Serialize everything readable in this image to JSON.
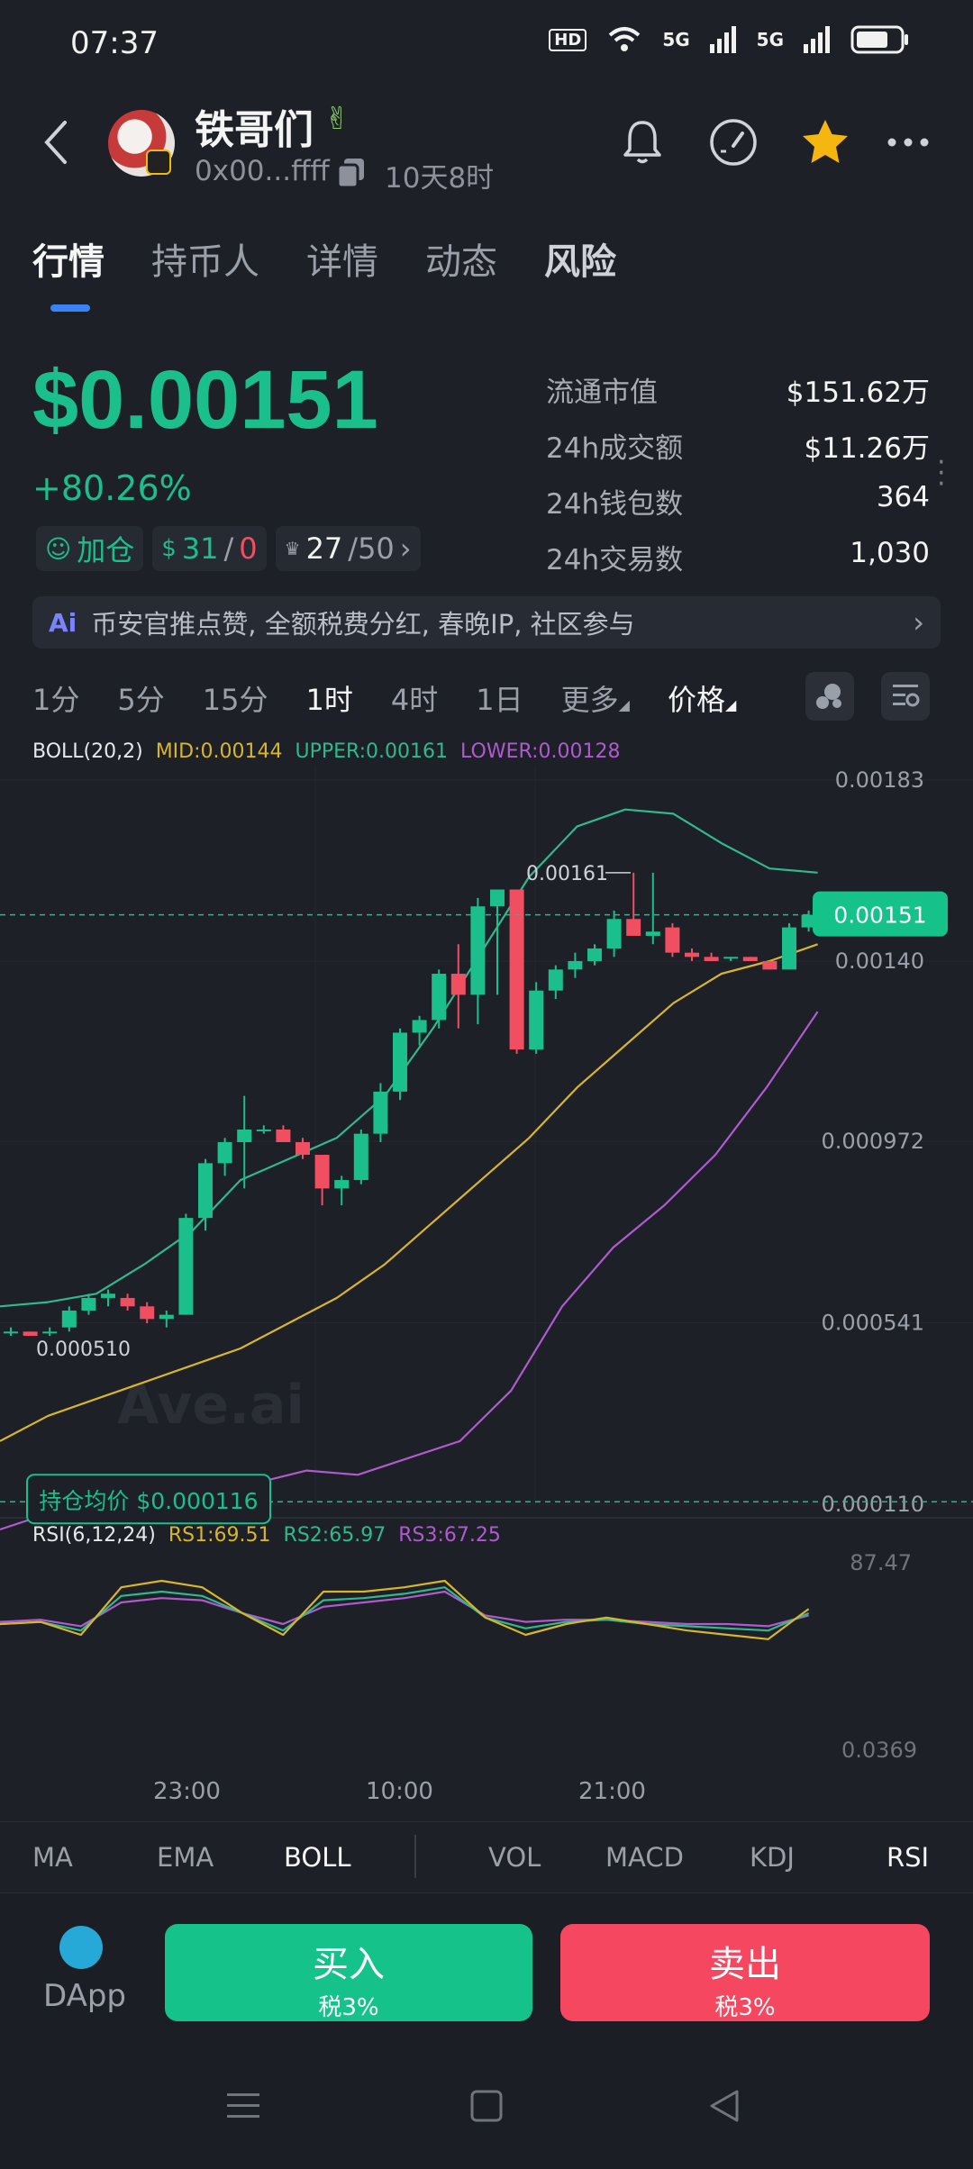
{
  "status_bar": {
    "time": "07:37",
    "hd_label": "HD",
    "net1": "5G",
    "net2": "5G"
  },
  "header": {
    "token_name": "铁哥们",
    "address": "0x00...ffff",
    "age": "10天8时"
  },
  "tabs": [
    "行情",
    "持币人",
    "详情",
    "动态",
    "风险"
  ],
  "price": {
    "value": "$0.00151",
    "change": "+80.26%"
  },
  "stats": [
    {
      "label": "流通市值",
      "value": "$151.62万"
    },
    {
      "label": "24h成交额",
      "value": "$11.26万"
    },
    {
      "label": "24h钱包数",
      "value": "364"
    },
    {
      "label": "24h交易数",
      "value": "1,030"
    }
  ],
  "chips": {
    "add_label": "加仓",
    "holders_a": "31",
    "holders_sep": "/",
    "holders_b": "0",
    "top_a": "27",
    "top_b": "/50"
  },
  "banner": {
    "ai": "Ai",
    "text": "币安官推点赞, 全额税费分红, 春晚IP, 社区参与"
  },
  "timeframes": [
    "1分",
    "5分",
    "15分",
    "1时",
    "4时",
    "1日",
    "更多",
    "价格"
  ],
  "boll_legend": {
    "name": "BOLL(20,2)",
    "mid": "MID:0.00144",
    "upper": "UPPER:0.00161",
    "lower": "LOWER:0.00128"
  },
  "rsi_legend": {
    "name": "RSI(6,12,24)",
    "rs1": "RS1:69.51",
    "rs2": "RS2:65.97",
    "rs3": "RS3:67.25"
  },
  "chart_labels": {
    "y_ticks": [
      "0.00183",
      "0.00140",
      "0.000972",
      "0.000541",
      "0.000110"
    ],
    "current_price": "0.00151",
    "high_marker": "0.00161",
    "low_marker": "0.000510",
    "avg_cost": "持仓均价 $0.000116",
    "watermark": "Ave.ai",
    "rsi_ticks": [
      "87.47",
      "0.0369"
    ],
    "time_ticks": [
      "23:00",
      "10:00",
      "21:00"
    ]
  },
  "colors": {
    "up": "#1bbf8b",
    "down": "#f04e61",
    "mid": "#d8b52c",
    "upper": "#2fb98c",
    "lower": "#b05ad0",
    "accent": "#3b82f6"
  },
  "chart_data": {
    "type": "candlestick",
    "timeframe": "1时",
    "y_ticks": [
      0.00183,
      0.0014,
      0.000972,
      0.000541,
      0.00011
    ],
    "candles": [
      [
        0.00052,
        0.00053,
        0.00051,
        0.00052
      ],
      [
        0.00052,
        0.00052,
        0.00051,
        0.00051
      ],
      [
        0.00052,
        0.00053,
        0.00051,
        0.00052
      ],
      [
        0.00053,
        0.00058,
        0.00052,
        0.00057
      ],
      [
        0.00057,
        0.00061,
        0.00056,
        0.0006
      ],
      [
        0.0006,
        0.00062,
        0.00058,
        0.00061
      ],
      [
        0.0006,
        0.00061,
        0.00057,
        0.00058
      ],
      [
        0.00058,
        0.00059,
        0.00054,
        0.00055
      ],
      [
        0.00055,
        0.00057,
        0.00053,
        0.00056
      ],
      [
        0.00056,
        0.0008,
        0.00056,
        0.00079
      ],
      [
        0.00079,
        0.00093,
        0.00076,
        0.00092
      ],
      [
        0.00092,
        0.00098,
        0.00089,
        0.00097
      ],
      [
        0.00097,
        0.00108,
        0.00086,
        0.001
      ],
      [
        0.001,
        0.00101,
        0.00099,
        0.001
      ],
      [
        0.001,
        0.00101,
        0.00097,
        0.00097
      ],
      [
        0.00097,
        0.00098,
        0.00093,
        0.00094
      ],
      [
        0.00094,
        0.00094,
        0.00082,
        0.00086
      ],
      [
        0.00086,
        0.00089,
        0.00082,
        0.00088
      ],
      [
        0.00088,
        0.001,
        0.00087,
        0.00099
      ],
      [
        0.00099,
        0.00111,
        0.00097,
        0.00109
      ],
      [
        0.00109,
        0.00124,
        0.00107,
        0.00123
      ],
      [
        0.00123,
        0.00127,
        0.0012,
        0.00126
      ],
      [
        0.00126,
        0.00138,
        0.00124,
        0.00137
      ],
      [
        0.00137,
        0.00144,
        0.00124,
        0.00132
      ],
      [
        0.00132,
        0.00155,
        0.00125,
        0.00153
      ],
      [
        0.00153,
        0.00157,
        0.00132,
        0.00157
      ],
      [
        0.00157,
        0.00157,
        0.00118,
        0.00119
      ],
      [
        0.00119,
        0.00135,
        0.00118,
        0.00133
      ],
      [
        0.00133,
        0.00139,
        0.00131,
        0.00138
      ],
      [
        0.00138,
        0.00142,
        0.00136,
        0.0014
      ],
      [
        0.0014,
        0.00144,
        0.00139,
        0.00143
      ],
      [
        0.00143,
        0.00152,
        0.00141,
        0.0015
      ],
      [
        0.0015,
        0.00161,
        0.00147,
        0.00146
      ],
      [
        0.00146,
        0.00161,
        0.00144,
        0.00147
      ],
      [
        0.00148,
        0.00149,
        0.00141,
        0.00142
      ],
      [
        0.00142,
        0.00143,
        0.0014,
        0.00141
      ],
      [
        0.00141,
        0.00142,
        0.0014,
        0.0014
      ],
      [
        0.00141,
        0.00141,
        0.0014,
        0.00141
      ],
      [
        0.00141,
        0.00141,
        0.0014,
        0.0014
      ],
      [
        0.0014,
        0.0014,
        0.00138,
        0.00138
      ],
      [
        0.00138,
        0.00149,
        0.00138,
        0.00148
      ],
      [
        0.00148,
        0.00152,
        0.00147,
        0.00151
      ]
    ],
    "boll_mid": [
      0.00026,
      0.00032,
      0.00036,
      0.0004,
      0.00044,
      0.00048,
      0.00054,
      0.0006,
      0.00068,
      0.00078,
      0.00088,
      0.00098,
      0.0011,
      0.0012,
      0.0013,
      0.00137,
      0.0014,
      0.00144
    ],
    "boll_upper": [
      0.00058,
      0.00059,
      0.00061,
      0.00068,
      0.00076,
      0.00088,
      0.00093,
      0.00098,
      0.00108,
      0.00124,
      0.00142,
      0.0016,
      0.00172,
      0.00176,
      0.00175,
      0.00168,
      0.00162,
      0.00161
    ],
    "boll_lower": [
      5e-05,
      9e-05,
      0.0001,
      0.00011,
      0.00013,
      0.00016,
      0.00019,
      0.00018,
      0.00022,
      0.00026,
      0.00038,
      0.00058,
      0.00072,
      0.00082,
      0.00094,
      0.0011,
      0.00128
    ],
    "rsi1": [
      55,
      56,
      50,
      72,
      75,
      72,
      60,
      50,
      70,
      70,
      72,
      75,
      58,
      50,
      55,
      58,
      55,
      52,
      50,
      48,
      62
    ],
    "rsi2": [
      55,
      56,
      52,
      68,
      70,
      68,
      60,
      52,
      66,
      67,
      69,
      72,
      58,
      53,
      56,
      57,
      55,
      54,
      53,
      52,
      60
    ],
    "rsi3": [
      56,
      57,
      54,
      65,
      67,
      66,
      60,
      55,
      63,
      65,
      67,
      70,
      59,
      56,
      57,
      57,
      56,
      55,
      55,
      54,
      59
    ],
    "rsi_ticks": [
      87.47,
      0.0369
    ]
  },
  "indicators": [
    "MA",
    "EMA",
    "BOLL",
    "VOL",
    "MACD",
    "KDJ",
    "RSI"
  ],
  "actions": {
    "dapp": "DApp",
    "buy": "买入",
    "buy_tax": "税3%",
    "sell": "卖出",
    "sell_tax": "税3%"
  }
}
